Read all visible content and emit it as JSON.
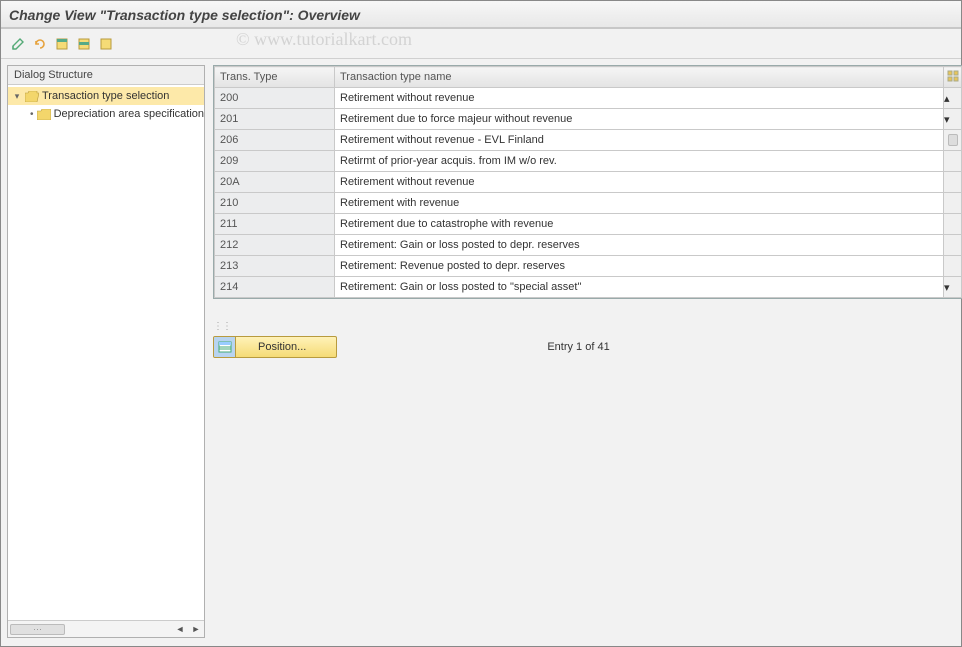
{
  "header": {
    "title": "Change View \"Transaction type selection\": Overview"
  },
  "watermark": "© www.tutorialkart.com",
  "toolbar": {
    "btn1": "change-button",
    "btn2": "undo-button",
    "btn3": "select-all-button",
    "btn4": "select-block-button",
    "btn5": "deselect-all-button"
  },
  "sidebar": {
    "header": "Dialog Structure",
    "node1_label": "Transaction type selection",
    "node2_label": "Depreciation area specification"
  },
  "table": {
    "col1": "Trans. Type",
    "col2": "Transaction type name",
    "rows": [
      {
        "code": "200",
        "name": "Retirement without revenue"
      },
      {
        "code": "201",
        "name": "Retirement due to force majeur without revenue"
      },
      {
        "code": "206",
        "name": "Retirement without revenue - EVL Finland"
      },
      {
        "code": "209",
        "name": "Retirmt of prior-year acquis. from IM w/o rev."
      },
      {
        "code": "20A",
        "name": "Retirement without revenue"
      },
      {
        "code": "210",
        "name": "Retirement with revenue"
      },
      {
        "code": "211",
        "name": "Retirement due to catastrophe with revenue"
      },
      {
        "code": "212",
        "name": "Retirement: Gain or loss posted to depr. reserves"
      },
      {
        "code": "213",
        "name": "Retirement: Revenue posted to depr. reserves"
      },
      {
        "code": "214",
        "name": "Retirement: Gain or loss posted to \"special asset\""
      }
    ]
  },
  "position_button": "Position...",
  "entry_status": "Entry 1 of 41"
}
